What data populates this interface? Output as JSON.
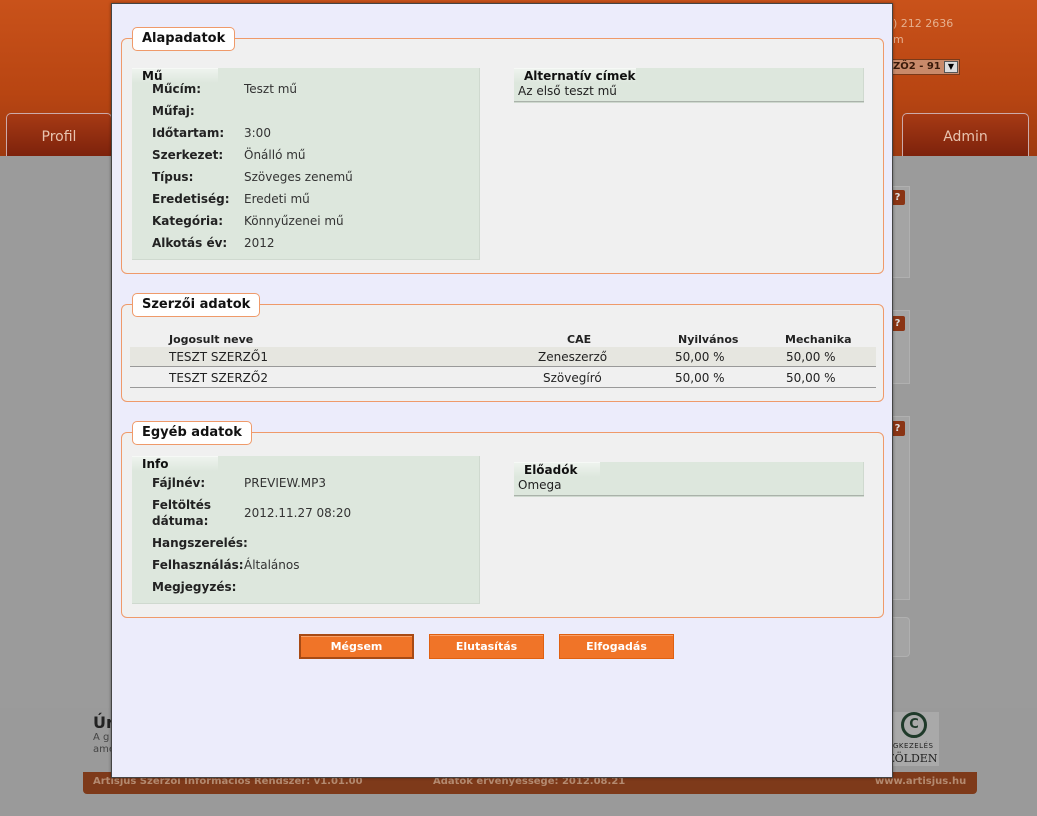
{
  "background": {
    "phone_fragment": ") 212 2636",
    "email_fragment": "m",
    "select_value": "ZŐ2 - 91",
    "tabs": [
      {
        "label": "Profil"
      },
      {
        "label": "Admin"
      }
    ],
    "help_glyph": "?",
    "footer_title": "Úr",
    "footer_line1": "A g",
    "footer_line2": "ame",
    "logo_symbol": "C",
    "logo_line1": "OGKEZELÉS",
    "logo_line2": "ZÖLDEN",
    "bottombar": {
      "system": "Artisjus Szerzői Információs Rendszer: v1.01.00",
      "validity": "Adatok érvényessége: 2012.08.21",
      "site": "www.artisjus.hu"
    }
  },
  "modal": {
    "alapadatok": {
      "legend": "Alapadatok",
      "mu_panel": {
        "title": "Mű",
        "rows": [
          {
            "label": "Műcím:",
            "value": "Teszt mű"
          },
          {
            "label": "Műfaj:",
            "value": ""
          },
          {
            "label": "Időtartam:",
            "value": "3:00"
          },
          {
            "label": "Szerkezet:",
            "value": "Önálló mű"
          },
          {
            "label": "Típus:",
            "value": "Szöveges zenemű"
          },
          {
            "label": "Eredetiség:",
            "value": "Eredeti mű"
          },
          {
            "label": "Kategória:",
            "value": "Könnyűzenei mű"
          },
          {
            "label": "Alkotás év:",
            "value": "2012"
          }
        ]
      },
      "alt_panel": {
        "title": "Alternatív címek",
        "items": [
          "Az első teszt mű"
        ]
      }
    },
    "szerzoi": {
      "legend": "Szerzői adatok",
      "columns": {
        "name": "Jogosult neve",
        "cae": "CAE",
        "public": "Nyilvános",
        "mech": "Mechanika"
      },
      "rows": [
        {
          "name": "TESZT SZERZŐ1",
          "cae": "Zeneszerző",
          "public": "50,00 %",
          "mech": "50,00 %"
        },
        {
          "name": "TESZT SZERZŐ2",
          "cae": "Szövegíró",
          "public": "50,00 %",
          "mech": "50,00 %"
        }
      ]
    },
    "egyeb": {
      "legend": "Egyéb adatok",
      "info_panel": {
        "title": "Info",
        "rows": [
          {
            "label": "Fájlnév:",
            "value": "PREVIEW.MP3"
          },
          {
            "label": "Feltöltés dátuma:",
            "label_line1": "Feltöltés",
            "label_line2": "dátuma:",
            "value": "2012.11.27 08:20"
          },
          {
            "label": "Hangszerelés:",
            "value": ""
          },
          {
            "label": "Felhasználás:",
            "value": "Általános"
          },
          {
            "label": "Megjegyzés:",
            "value": ""
          }
        ]
      },
      "eloadok_panel": {
        "title": "Előadók",
        "items": [
          "Omega"
        ]
      }
    },
    "buttons": {
      "cancel": "Mégsem",
      "reject": "Elutasítás",
      "accept": "Elfogadás"
    }
  },
  "colors": {
    "accent": "#f07428",
    "section_border": "#ef9a6a",
    "panel_bg": "#dde7dd",
    "modal_bg": "#ececfb"
  }
}
